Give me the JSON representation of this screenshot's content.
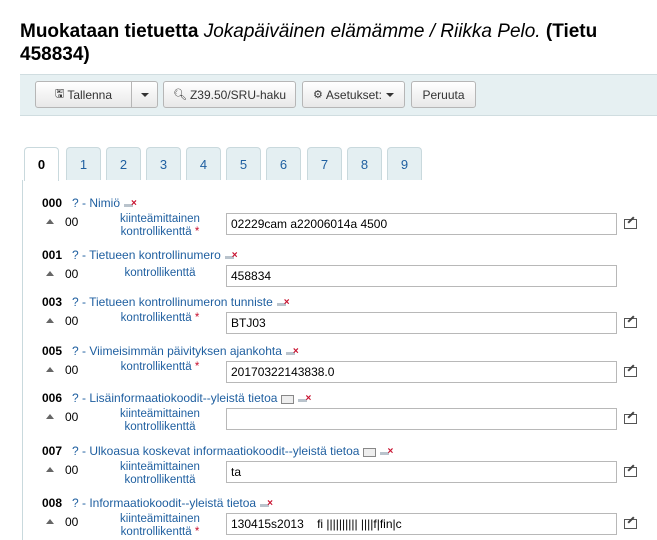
{
  "header": {
    "title_prefix": "Muokataan tietuetta",
    "title_italic": "Jokapäiväinen elämämme / Riikka Pelo.",
    "title_suffix": "(Tietu",
    "title_line2": "458834)"
  },
  "toolbar": {
    "save_label": "Tallenna",
    "z3950_label": "Z39.50/SRU-haku",
    "settings_label": "Asetukset:",
    "cancel_label": "Peruuta"
  },
  "tabs": [
    "0",
    "1",
    "2",
    "3",
    "4",
    "5",
    "6",
    "7",
    "8",
    "9"
  ],
  "active_tab": "0",
  "fields": [
    {
      "tag": "000",
      "desc": "? - Nimiö",
      "ind": "00",
      "label_line1": "kiinteämittainen",
      "label_line2": "kontrollikenttä",
      "required": "*",
      "value": "02229cam a22006014a 4500"
    },
    {
      "tag": "001",
      "desc": "? - Tietueen kontrollinumero",
      "ind": "00",
      "label_line1": "kontrollikenttä",
      "label_line2": "",
      "required": "",
      "value": "458834"
    },
    {
      "tag": "003",
      "desc": "? - Tietueen kontrollinumeron tunniste",
      "ind": "00",
      "label_line1": "kontrollikenttä",
      "label_line2": "",
      "required": "*",
      "value": "BTJ03"
    },
    {
      "tag": "005",
      "desc": "? - Viimeisimmän päivityksen ajankohta",
      "ind": "00",
      "label_line1": "kontrollikenttä",
      "label_line2": "",
      "required": "*",
      "value": "20170322143838.0"
    },
    {
      "tag": "006",
      "desc": "? - Lisäinformaatiokoodit--yleistä tietoa",
      "ind": "00",
      "label_line1": "kiinteämittainen",
      "label_line2": "kontrollikenttä",
      "required": "",
      "value": ""
    },
    {
      "tag": "007",
      "desc": "? - Ulkoasua koskevat informaatiokoodit--yleistä tietoa",
      "ind": "00",
      "label_line1": "kiinteämittainen",
      "label_line2": "kontrollikenttä",
      "required": "",
      "value": "ta"
    },
    {
      "tag": "008",
      "desc": "? - Informaatiokoodit--yleistä tietoa",
      "ind": "00",
      "label_line1": "kiinteämittainen",
      "label_line2": "kontrollikenttä",
      "required": "*",
      "value": "130415s2013    fi |||||||||| ||||f|fin|c"
    }
  ],
  "colors": {
    "link": "#1f5fa0",
    "required": "#c8102e",
    "toolbar_bg": "#e6f0f2"
  }
}
